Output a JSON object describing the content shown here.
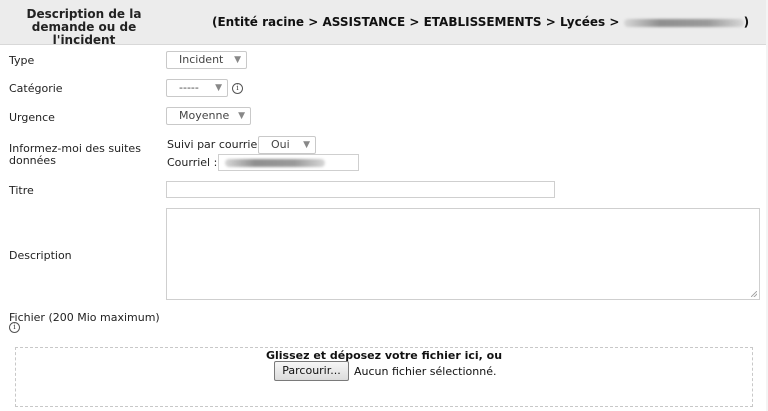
{
  "header": {
    "left_title": "Description de la demande ou de l'incident",
    "breadcrumb": "(Entité racine > ASSISTANCE > ETABLISSEMENTS > Lycées >",
    "breadcrumb_end": ")"
  },
  "form": {
    "type": {
      "label": "Type",
      "value": "Incident"
    },
    "categorie": {
      "label": "Catégorie",
      "value": "-----"
    },
    "urgence": {
      "label": "Urgence",
      "value": "Moyenne"
    },
    "suivi": {
      "label": "Informez-moi des suites données",
      "courriel_label": "Suivi par courriel",
      "courriel_value": "Oui",
      "email_label": "Courriel :"
    },
    "titre": {
      "label": "Titre"
    },
    "description": {
      "label": "Description"
    },
    "fichier": {
      "label": "Fichier (200 Mio maximum)"
    }
  },
  "dropzone": {
    "text": "Glissez et déposez votre fichier ici, ou",
    "browse_label": "Parcourir...",
    "no_file": "Aucun fichier sélectionné."
  },
  "icons": {
    "info": "i"
  }
}
